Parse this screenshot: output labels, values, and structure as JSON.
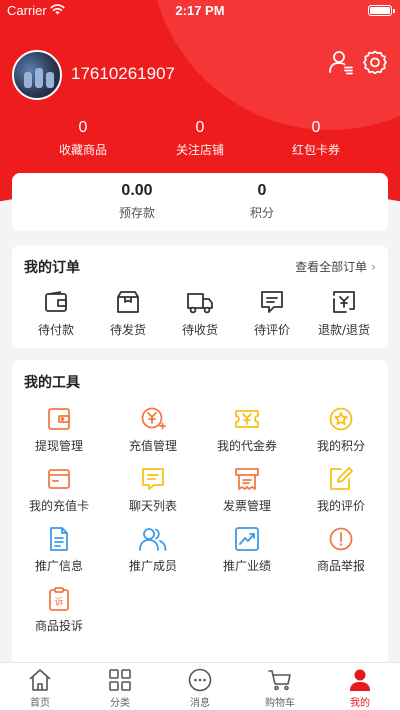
{
  "status_bar": {
    "carrier": "Carrier",
    "time": "2:17 PM"
  },
  "profile": {
    "username": "17610261907"
  },
  "stats": [
    {
      "value": "0",
      "label": "收藏商品"
    },
    {
      "value": "0",
      "label": "关注店铺"
    },
    {
      "value": "0",
      "label": "红包卡券"
    }
  ],
  "balance": [
    {
      "value": "0.00",
      "label": "预存款"
    },
    {
      "value": "0",
      "label": "积分"
    }
  ],
  "orders": {
    "title": "我的订单",
    "view_all": "查看全部订单",
    "items": [
      {
        "label": "待付款",
        "icon": "wallet-icon"
      },
      {
        "label": "待发货",
        "icon": "box-icon"
      },
      {
        "label": "待收货",
        "icon": "truck-icon"
      },
      {
        "label": "待评价",
        "icon": "comment-icon"
      },
      {
        "label": "退款/退货",
        "icon": "refund-icon"
      }
    ]
  },
  "tools": {
    "title": "我的工具",
    "items": [
      {
        "label": "提现管理",
        "icon": "withdraw-icon",
        "color": "#f07a45"
      },
      {
        "label": "充值管理",
        "icon": "recharge-icon",
        "color": "#f07a45"
      },
      {
        "label": "我的代金券",
        "icon": "voucher-icon",
        "color": "#f4c216"
      },
      {
        "label": "我的积分",
        "icon": "points-icon",
        "color": "#f4c216"
      },
      {
        "label": "我的充值卡",
        "icon": "recharge-card-icon",
        "color": "#f07a45"
      },
      {
        "label": "聊天列表",
        "icon": "chat-list-icon",
        "color": "#f4c216"
      },
      {
        "label": "发票管理",
        "icon": "invoice-icon",
        "color": "#f07a45"
      },
      {
        "label": "我的评价",
        "icon": "review-icon",
        "color": "#f4c216"
      },
      {
        "label": "推广信息",
        "icon": "promo-info-icon",
        "color": "#3f9be8"
      },
      {
        "label": "推广成员",
        "icon": "promo-members-icon",
        "color": "#3f9be8"
      },
      {
        "label": "推广业绩",
        "icon": "promo-performance-icon",
        "color": "#3f9be8"
      },
      {
        "label": "商品举报",
        "icon": "report-icon",
        "color": "#f07a45"
      },
      {
        "label": "商品投诉",
        "icon": "complaint-icon",
        "color": "#f07a45"
      }
    ]
  },
  "tabbar": {
    "active": "我的",
    "items": [
      {
        "label": "首页",
        "icon": "home-icon"
      },
      {
        "label": "分类",
        "icon": "category-icon"
      },
      {
        "label": "消息",
        "icon": "message-icon"
      },
      {
        "label": "购物车",
        "icon": "cart-icon"
      },
      {
        "label": "我的",
        "icon": "user-icon"
      }
    ]
  },
  "colors": {
    "brand": "#ee1c1c",
    "active_tab": "#e51a1a",
    "tool_blue": "#3f9be8",
    "tool_orange": "#f07a45",
    "tool_yellow": "#f4c216"
  }
}
